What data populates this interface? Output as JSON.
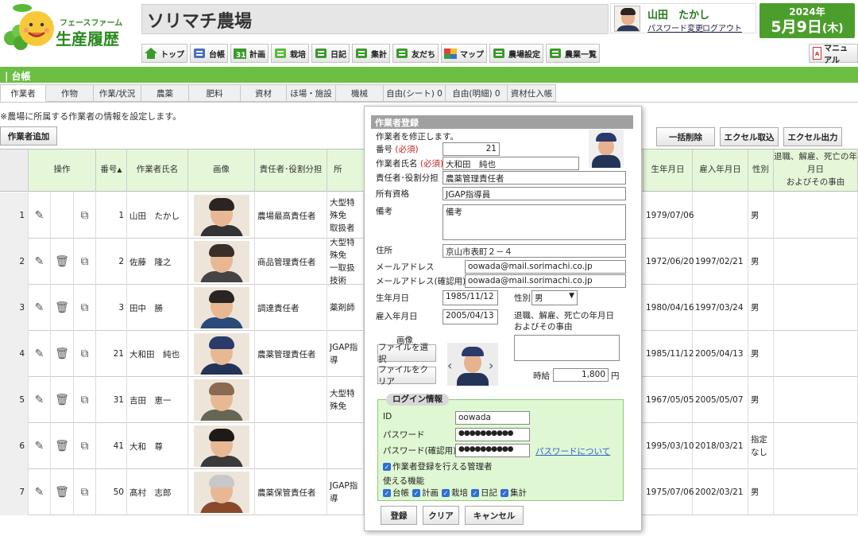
{
  "brand": {
    "tagline": "フェースファーム",
    "name": "生産履歴"
  },
  "farm": {
    "name": "ソリマチ農場"
  },
  "user": {
    "name": "山田　たかし",
    "password_change": "パスワード変更",
    "logout": "ログアウト"
  },
  "date": {
    "year": "2024年",
    "month_day": "5月9日",
    "weekday": "(木)"
  },
  "nav": [
    {
      "label": "トップ",
      "icon": "home-icon",
      "color": "#3a9a2a"
    },
    {
      "label": "台帳",
      "icon": "ledger-icon",
      "color": "#4a6fb8"
    },
    {
      "label": "計画",
      "icon": "calendar-icon",
      "color": "#3a9a2a"
    },
    {
      "label": "栽培",
      "icon": "sprout-icon",
      "color": "#5ab83a"
    },
    {
      "label": "日記",
      "icon": "diary-icon",
      "color": "#3a9a2a"
    },
    {
      "label": "集計",
      "icon": "spreadsheet-icon",
      "color": "#3a9a2a"
    },
    {
      "label": "友だち",
      "icon": "friends-icon",
      "color": "#3a9a2a"
    },
    {
      "label": "マップ",
      "icon": "map-icon",
      "color": "#d04040"
    },
    {
      "label": "農場設定",
      "icon": "farm-settings-icon",
      "color": "#3a9a2a"
    },
    {
      "label": "農業一覧",
      "icon": "farm-list-icon",
      "color": "#3a9a2a"
    }
  ],
  "manual": "マニュアル",
  "section": "| 台帳",
  "tabs": [
    "作業者",
    "作物",
    "作業/状況",
    "農薬",
    "肥料",
    "資材",
    "ほ場・施設",
    "機械",
    "自由(シート) 0",
    "自由(明細) 0",
    "資材仕入帳"
  ],
  "note": "※農場に所属する作業者の情報を設定します。",
  "buttons": {
    "add_worker": "作業者追加",
    "bulk_delete": "一括削除",
    "excel_import": "エクセル取込",
    "excel_export": "エクセル出力"
  },
  "table": {
    "headers": {
      "ops": "操作",
      "number": "番号",
      "name": "作業者氏名",
      "image": "画像",
      "role": "責任者･役割分担",
      "qual": "所",
      "birth": "生年月日",
      "hire": "雇入年月日",
      "gender": "性別",
      "retire": "退職、解雇、死亡の年月日\nおよびその事由"
    },
    "rows": [
      {
        "row": "1",
        "number": "1",
        "name": "山田　たかし",
        "role": "農場最高責任者",
        "qual": "大型特殊免\n取扱者",
        "birth": "1979/07/06",
        "hire": "",
        "gender": "男",
        "deletable": false
      },
      {
        "row": "2",
        "number": "2",
        "name": "佐藤　隆之",
        "role": "商品管理責任者",
        "qual": "大型特殊免\n一取扱技術",
        "birth": "1972/06/20",
        "hire": "1997/02/21",
        "gender": "男",
        "deletable": true
      },
      {
        "row": "3",
        "number": "3",
        "name": "田中　勝",
        "role": "調達責任者",
        "qual": "薬剤師",
        "birth": "1980/04/16",
        "hire": "1997/03/24",
        "gender": "男",
        "deletable": true
      },
      {
        "row": "4",
        "number": "21",
        "name": "大和田　純也",
        "role": "農薬管理責任者",
        "qual": "JGAP指導",
        "birth": "1985/11/12",
        "hire": "2005/04/13",
        "gender": "男",
        "deletable": true
      },
      {
        "row": "5",
        "number": "31",
        "name": "吉田　恵一",
        "role": "",
        "qual": "大型特殊免",
        "birth": "1967/05/05",
        "hire": "2005/05/07",
        "gender": "男",
        "deletable": true
      },
      {
        "row": "6",
        "number": "41",
        "name": "大和　尊",
        "role": "",
        "qual": "",
        "birth": "1995/03/10",
        "hire": "2018/03/21",
        "gender": "指定\nなし",
        "deletable": true
      },
      {
        "row": "7",
        "number": "50",
        "name": "髙村　志郎",
        "role": "農薬保管責任者",
        "qual": "JGAP指導",
        "birth": "1975/07/06",
        "hire": "2002/03/21",
        "gender": "男",
        "deletable": true
      }
    ]
  },
  "dialog": {
    "title": "作業者登録",
    "subtitle": "作業者を修正します。",
    "number_label": "番号",
    "required": "(必須)",
    "number_value": "21",
    "name_label": "作業者氏名",
    "name_value": "大和田　純也",
    "role_label": "責任者･役割分担",
    "role_value": "農薬管理責任者",
    "qual_label": "所有資格",
    "qual_value": "JGAP指導員",
    "memo_label": "備考",
    "memo_value": "備考",
    "address_label": "住所",
    "address_value": "京山市表町２－４",
    "email_label": "メールアドレス",
    "email_value": "oowada@mail.sorimachi.co.jp",
    "email_confirm_label": "メールアドレス(確認用)",
    "email_confirm_value": "oowada@mail.sorimachi.co.jp",
    "birth_label": "生年月日",
    "birth_value": "1985/11/12",
    "gender_label": "性別",
    "gender_value": "男",
    "hire_label": "雇入年月日",
    "hire_value": "2005/04/13",
    "retire_label": "退職、解雇、死亡の年月日\nおよびその事由",
    "image_label": "画像",
    "select_file": "ファイルを選択",
    "clear_file": "ファイルをクリア",
    "wage_label": "時給",
    "wage_value": "1,800",
    "wage_unit": "円",
    "login": {
      "legend": "ログイン情報",
      "id_label": "ID",
      "id_value": "oowada",
      "password_label": "パスワード",
      "password_value": "●●●●●●●●●●",
      "password_confirm_label": "パスワード(確認用)",
      "password_confirm_value": "●●●●●●●●●●",
      "password_help": "パスワードについて",
      "admin_label": "作業者登録を行える管理者",
      "features_label": "使える機能",
      "features": [
        "台帳",
        "計画",
        "栽培",
        "日記",
        "集計"
      ]
    },
    "register": "登録",
    "clear": "クリア",
    "cancel": "キャンセル"
  }
}
